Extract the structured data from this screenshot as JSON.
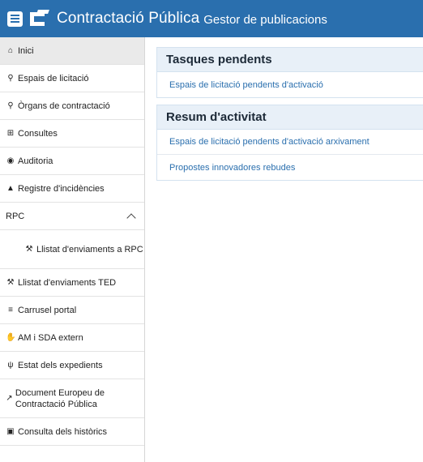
{
  "header": {
    "title": "Contractació Pública",
    "subtitle": "Gestor de publicacions"
  },
  "sidebar": {
    "items": [
      {
        "label": "Inici",
        "icon": "home-icon"
      },
      {
        "label": "Espais de licitació",
        "icon": "search-icon"
      },
      {
        "label": "Òrgans de contractació",
        "icon": "search-icon"
      },
      {
        "label": "Consultes",
        "icon": "table-icon"
      },
      {
        "label": "Auditoria",
        "icon": "eye-icon"
      },
      {
        "label": "Registre d'incidències",
        "icon": "warning-icon"
      },
      {
        "label": "RPC",
        "icon": "chevron-up-icon"
      },
      {
        "label": "Llistat d'enviaments a RPC",
        "icon": "gavel-icon"
      },
      {
        "label": "Llistat d'enviaments TED",
        "icon": "gavel-icon"
      },
      {
        "label": "Carrusel portal",
        "icon": "list-icon"
      },
      {
        "label": "AM i SDA extern",
        "icon": "handshake-icon"
      },
      {
        "label": "Estat dels expedients",
        "icon": "status-icon"
      },
      {
        "label": "Document Europeu de Contractació Pública",
        "icon": "external-link-icon"
      },
      {
        "label": "Consulta dels històrics",
        "icon": "archive-icon"
      }
    ]
  },
  "panels": {
    "pending": {
      "title": "Tasques pendents",
      "rows": [
        "Espais de licitació pendents d'activació"
      ]
    },
    "activity": {
      "title": "Resum d'activitat",
      "rows": [
        "Espais de licitació pendents d'activació arxivament",
        "Propostes innovadores rebudes"
      ]
    }
  },
  "colors": {
    "accent": "#2a6fae",
    "panel_header": "#e8f0f8"
  }
}
